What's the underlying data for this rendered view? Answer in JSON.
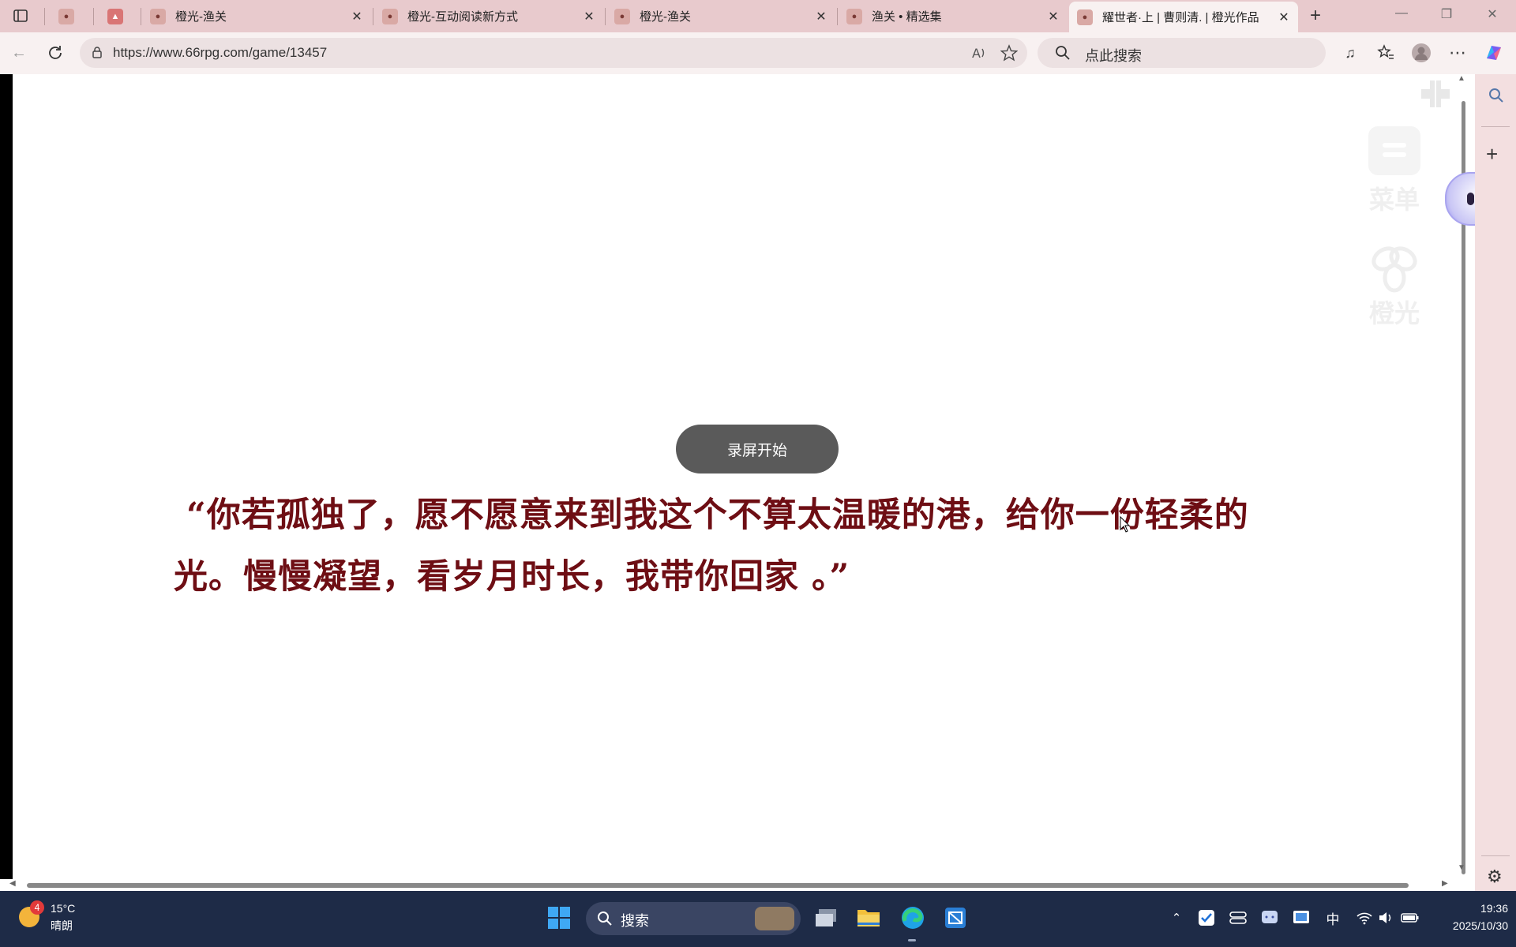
{
  "tabs": [
    {
      "label": "",
      "favicon": "avatar-favicon"
    },
    {
      "label": "",
      "favicon": "warning-favicon"
    },
    {
      "label": "橙光-渔关",
      "favicon": "avatar-favicon"
    },
    {
      "label": "橙光-互动阅读新方式",
      "favicon": "avatar-favicon"
    },
    {
      "label": "橙光-渔关",
      "favicon": "avatar-favicon"
    },
    {
      "label": "渔关 • 精选集",
      "favicon": "avatar-favicon"
    },
    {
      "label": "耀世者·上 | 曹则清. | 橙光作品",
      "favicon": "avatar-favicon",
      "active": true
    }
  ],
  "address": {
    "url": "https://www.66rpg.com/game/13457"
  },
  "search": {
    "placeholder": "点此搜索"
  },
  "game": {
    "record_button": "录屏开始",
    "quote_line1": "“你若孤独了，愿不愿意来到我这个不算太温暖的港，给你一份轻柔的",
    "quote_line2": "光。慢慢凝望，看岁月时长，我带你回家 。”",
    "menu_label": "菜单",
    "brand_label": "橙光"
  },
  "taskbar": {
    "weather_temp": "15°C",
    "weather_desc": "晴朗",
    "weather_badge": "4",
    "search_label": "搜索",
    "ime": "中",
    "time": "19:36",
    "date": "2025/10/30"
  },
  "colors": {
    "tabbar": "#e8cacd",
    "toolbar": "#f8f1f1",
    "quote": "#6e0e14",
    "taskbar": "#1e2b47"
  }
}
